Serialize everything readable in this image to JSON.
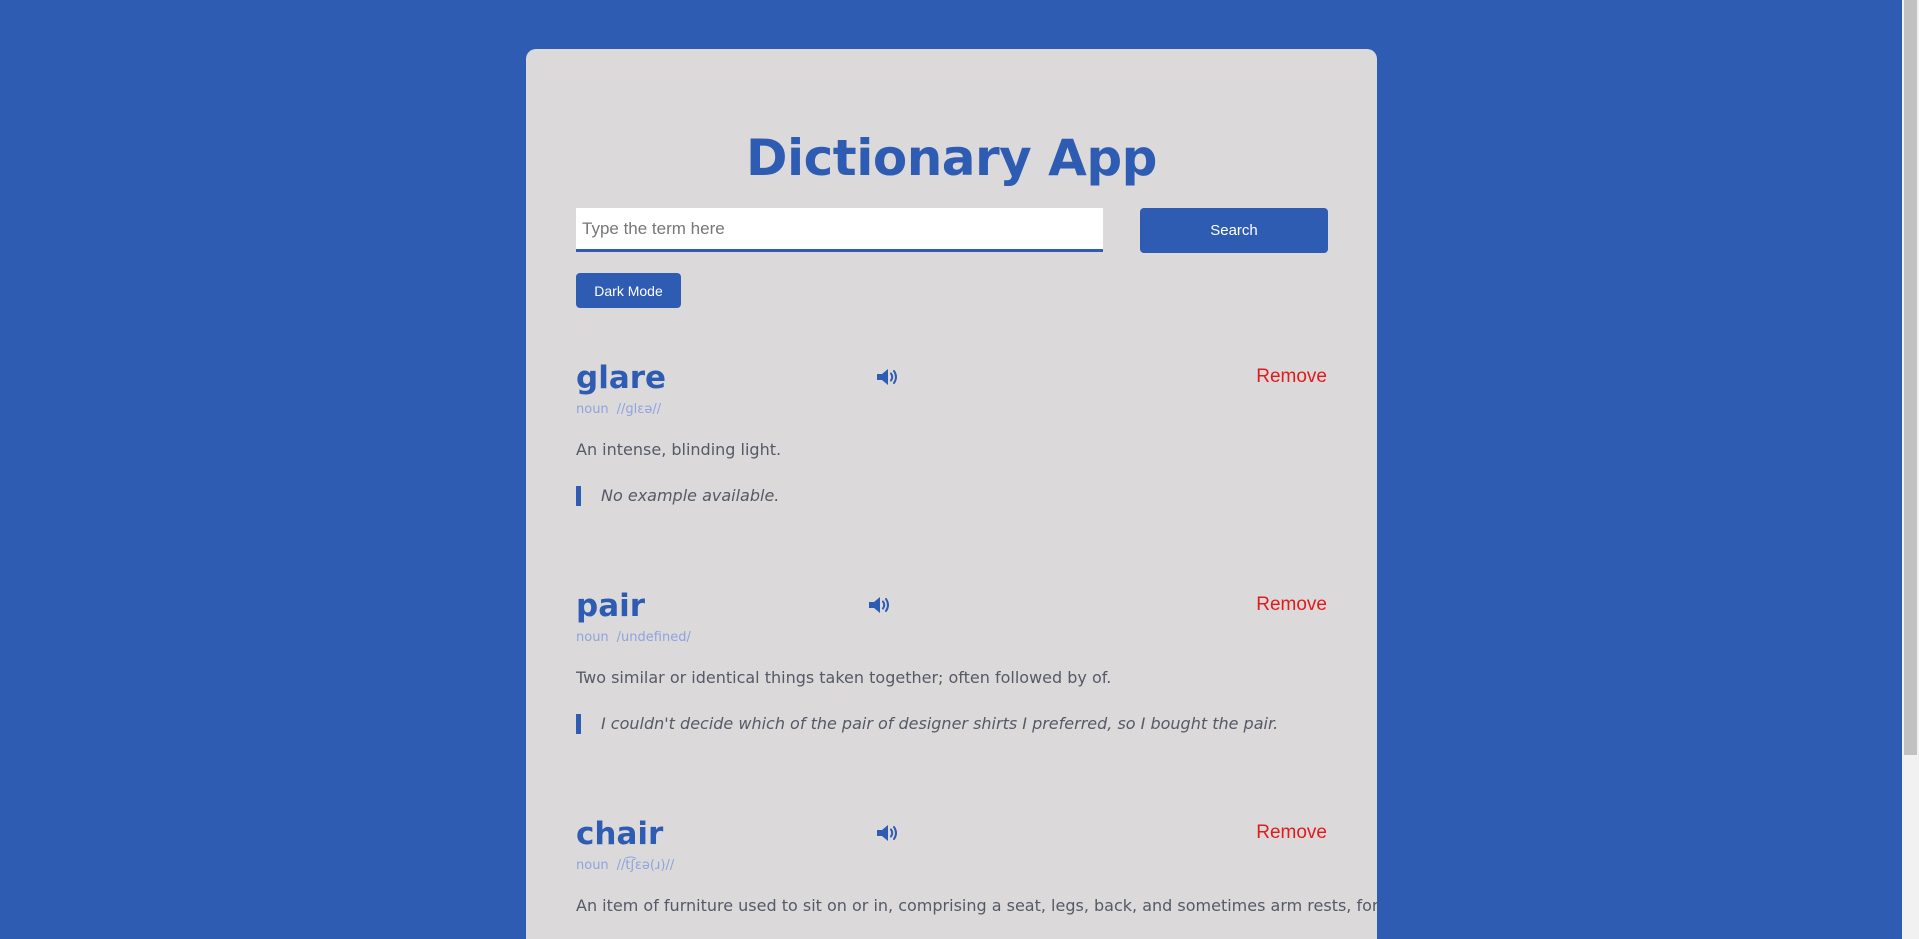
{
  "app": {
    "title": "Dictionary App"
  },
  "search": {
    "placeholder": "Type the term here",
    "value": "",
    "button_label": "Search"
  },
  "theme": {
    "dark_mode_label": "Dark Mode"
  },
  "colors": {
    "brand": "#2e5cb3",
    "card_background": "#dbd9da",
    "remove": "#e01b1b",
    "meta": "#8ea4dd"
  },
  "entries": [
    {
      "word": "glare",
      "part_of_speech": "noun",
      "phonetic": "//ɡlɛə//",
      "definition": "An intense, blinding light.",
      "example": "No example available.",
      "remove_label": "Remove",
      "audio_icon": "speaker-icon"
    },
    {
      "word": "pair",
      "part_of_speech": "noun",
      "phonetic": "/undefined/",
      "definition": "Two similar or identical things taken together; often followed by of.",
      "example": "I couldn't decide which of the pair of designer shirts I preferred, so I bought the pair.",
      "remove_label": "Remove",
      "audio_icon": "speaker-icon"
    },
    {
      "word": "chair",
      "part_of_speech": "noun",
      "phonetic": "//t͡ʃɛə(ɹ)//",
      "definition": "An item of furniture used to sit on or in, comprising a seat, legs, back, and sometimes arm rests, for",
      "remove_label": "Remove",
      "audio_icon": "speaker-icon"
    }
  ]
}
